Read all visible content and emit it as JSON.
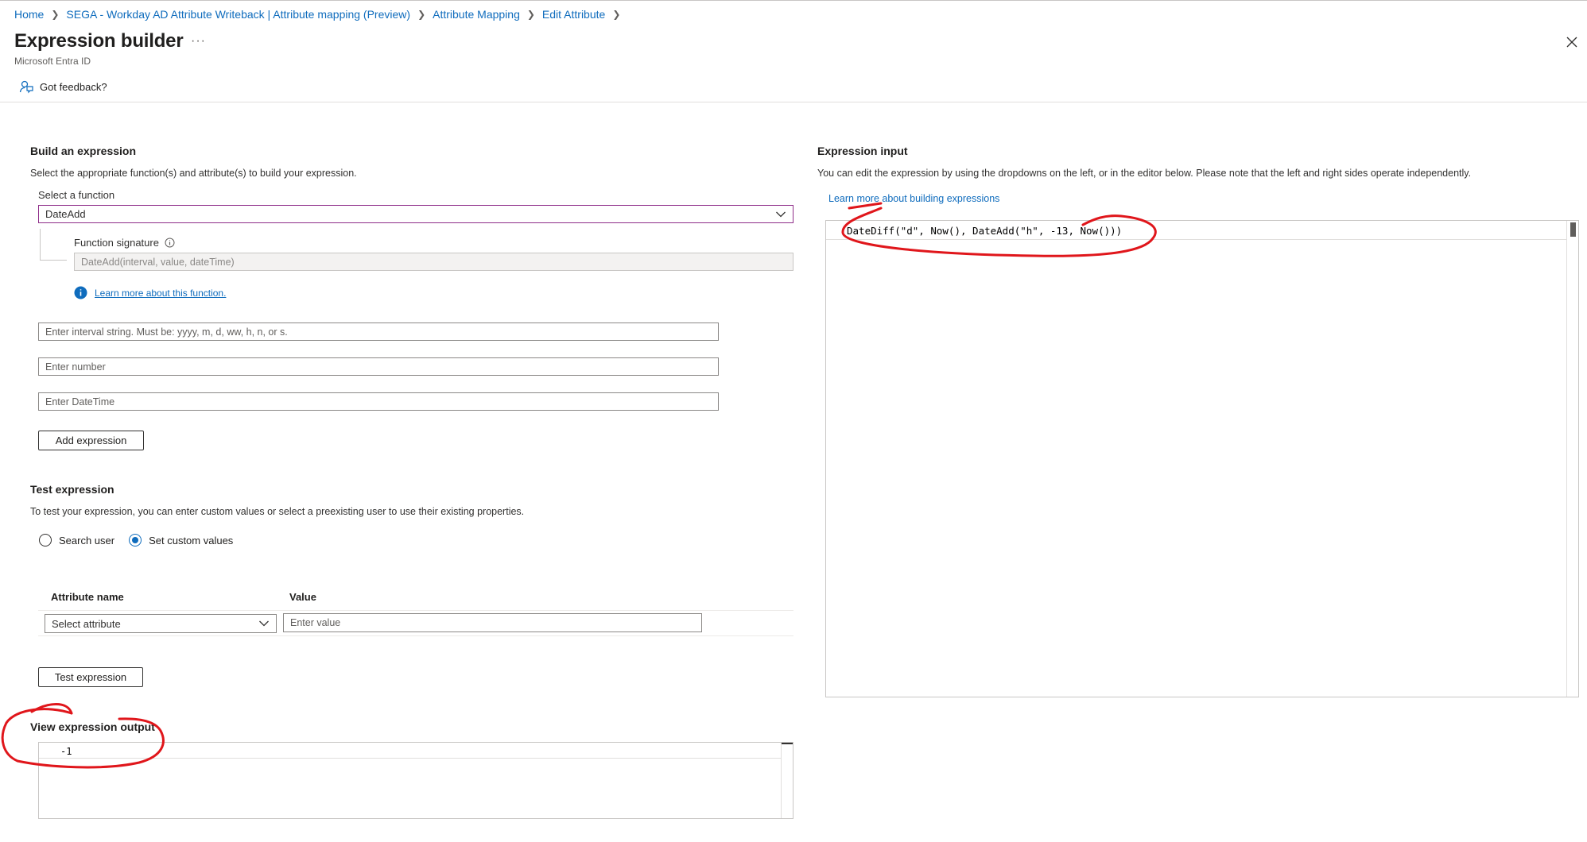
{
  "breadcrumb": [
    {
      "label": "Home"
    },
    {
      "label": "SEGA - Workday AD Attribute Writeback | Attribute mapping (Preview)"
    },
    {
      "label": "Attribute Mapping"
    },
    {
      "label": "Edit Attribute"
    }
  ],
  "header": {
    "title": "Expression builder",
    "more_label": "···",
    "subtitle": "Microsoft Entra ID",
    "feedback_label": "Got feedback?"
  },
  "build": {
    "heading": "Build an expression",
    "description": "Select the appropriate function(s) and attribute(s) to build your expression.",
    "function_label": "Select a function",
    "function_value": "DateAdd",
    "signature_label": "Function signature",
    "signature_value": "DateAdd(interval, value, dateTime)",
    "learn_function": "Learn more about this function.",
    "interval_placeholder": "Enter interval string. Must be: yyyy, m, d, ww, h, n, or s.",
    "number_placeholder": "Enter number",
    "datetime_placeholder": "Enter DateTime",
    "add_button": "Add expression"
  },
  "test": {
    "heading": "Test expression",
    "description": "To test your expression, you can enter custom values or select a preexisting user to use their existing properties.",
    "radio_search": "Search user",
    "radio_custom": "Set custom values",
    "selected_radio": "Set custom values",
    "col_attribute": "Attribute name",
    "col_value": "Value",
    "attribute_placeholder": "Select attribute",
    "value_placeholder": "Enter value",
    "test_button": "Test expression"
  },
  "output": {
    "heading": "View expression output",
    "value": "-1"
  },
  "input": {
    "heading": "Expression input",
    "description": "You can edit the expression by using the dropdowns on the left, or in the editor below. Please note that the left and right sides operate independently.",
    "learn_link": "Learn more about building expressions",
    "expression": "DateDiff(\"d\", Now(), DateAdd(\"h\", -13, Now()))"
  },
  "colors": {
    "link": "#0f6cbd",
    "focus_border": "#8e2c89",
    "annotation": "#e0161b"
  }
}
